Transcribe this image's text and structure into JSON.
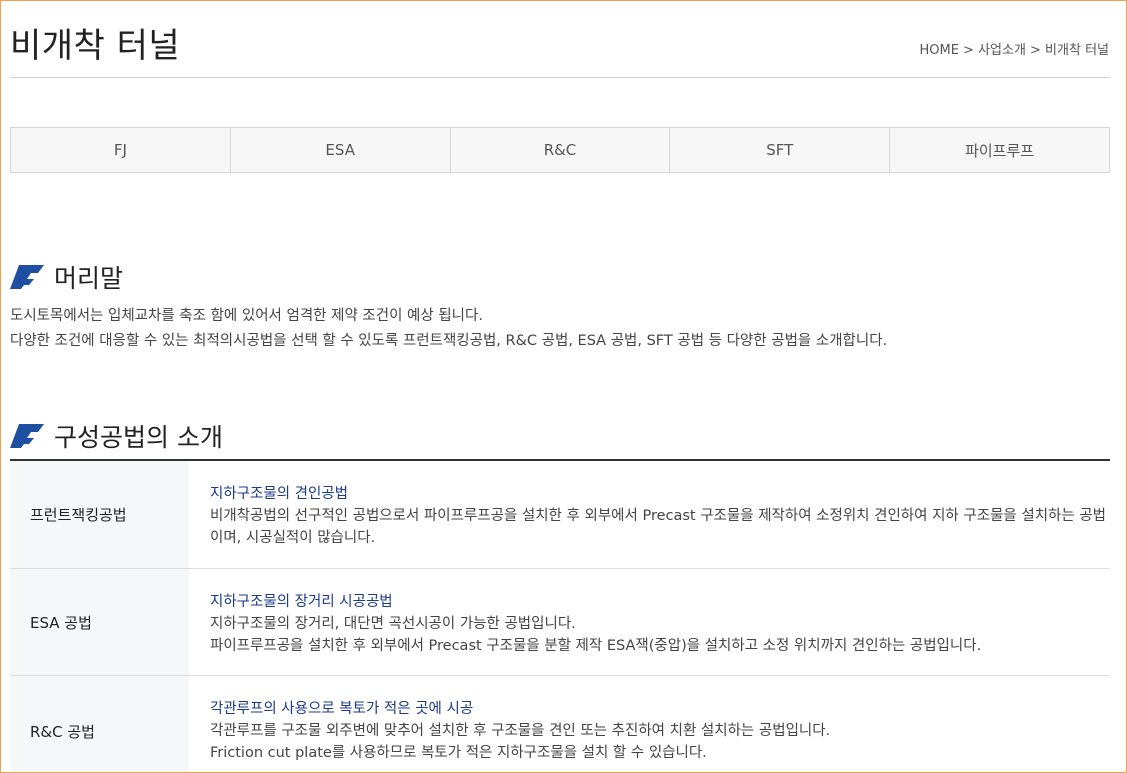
{
  "page": {
    "title": "비개착 터널",
    "breadcrumb": "HOME > 사업소개 > 비개착 터널"
  },
  "tabs": [
    {
      "label": "FJ"
    },
    {
      "label": "ESA"
    },
    {
      "label": "R&C"
    },
    {
      "label": "SFT"
    },
    {
      "label": "파이프루프"
    }
  ],
  "intro": {
    "heading": "머리말",
    "lines": [
      "도시토목에서는 입체교차를 축조 함에 있어서 엄격한 제약 조건이 예상 됩니다.",
      "다양한 조건에 대응할 수 있는 최적의시공법을 선택 할 수 있도록 프런트잭킹공법, R&C 공법, ESA 공법, SFT 공법 등 다양한 공법을 소개합니다."
    ]
  },
  "methods": {
    "heading": "구성공법의 소개",
    "rows": [
      {
        "name": "프런트잭킹공법",
        "heading": "지하구조물의 견인공법",
        "lines": [
          "비개착공법의 선구적인 공법으로서 파이프루프공을 설치한 후 외부에서 Precast 구조물을 제작하여 소정위치 견인하여 지하 구조물을 설치하는 공법이며, 시공실적이 많습니다."
        ]
      },
      {
        "name": "ESA 공법",
        "heading": "지하구조물의 장거리 시공공법",
        "lines": [
          "지하구조물의 장거리, 대단면 곡선시공이 가능한 공법입니다.",
          "파이프루프공을 설치한 후 외부에서 Precast 구조물을 분할 제작 ESA잭(중압)을 설치하고 소정 위치까지 견인하는 공법입니다."
        ]
      },
      {
        "name": "R&C 공법",
        "heading": "각관루프의 사용으로 복토가 적은 곳에 시공",
        "lines": [
          "각관루프를 구조물 외주변에 맞추어 설치한 후 구조물을 견인 또는 추진하여 치환 설치하는 공법입니다.",
          "Friction cut plate를 사용하므로 복토가 적은 지하구조물을 설치 할 수 있습니다."
        ]
      }
    ]
  },
  "colors": {
    "accent_icon": "#1f4fa0",
    "heading_link": "#1a3a8c",
    "frame_border": "#f0a24a"
  },
  "icons": {
    "section_marker": "blue-parallelogram-icon"
  }
}
